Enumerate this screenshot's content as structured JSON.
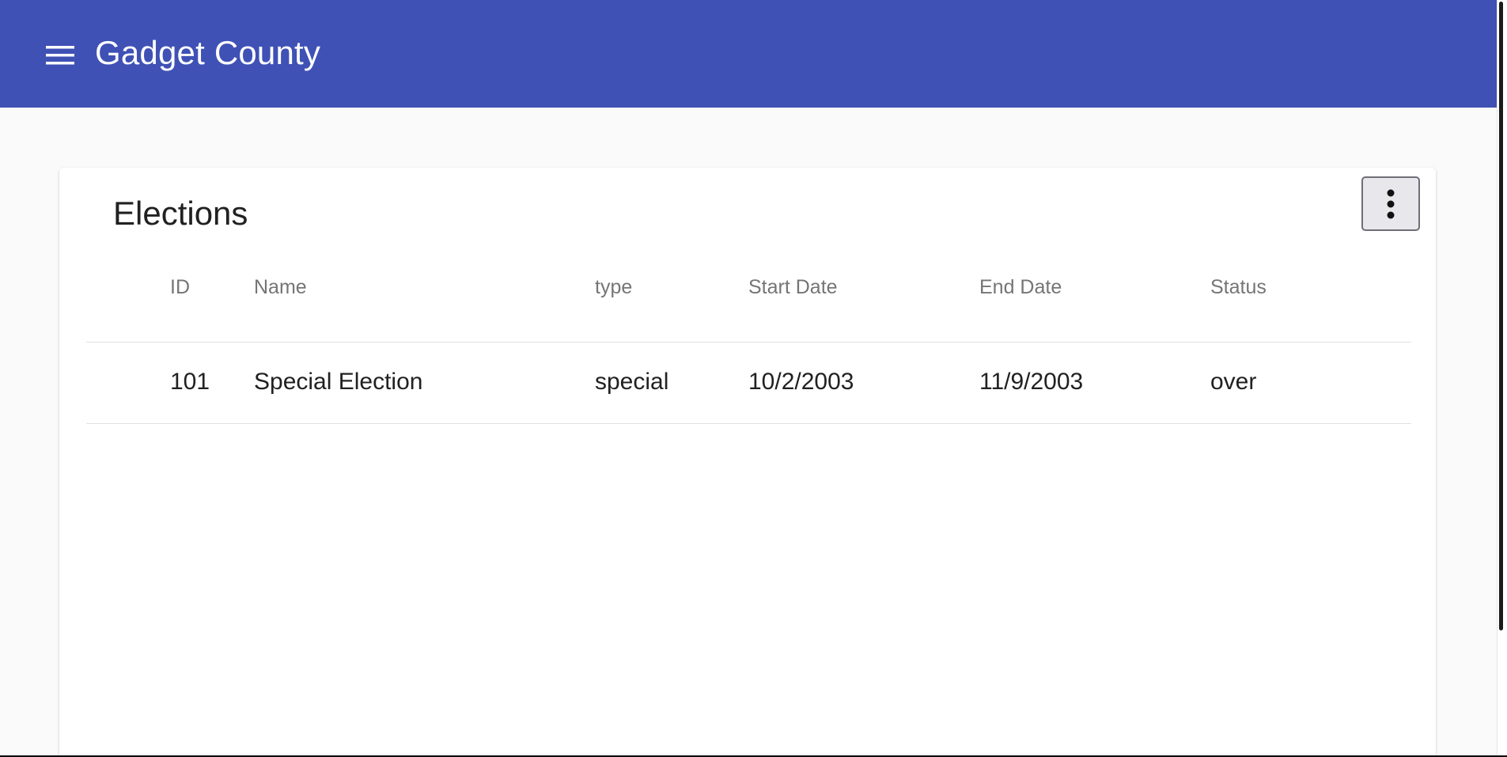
{
  "app": {
    "title": "Gadget County",
    "menu_icon": "menu-icon",
    "colors": {
      "appbar": "#3f51b5",
      "background": "#fafafa",
      "card": "#ffffff",
      "header_text": "#757575",
      "body_text": "#212121"
    }
  },
  "card": {
    "title": "Elections",
    "more_icon": "more-vertical-icon"
  },
  "table": {
    "columns": [
      "ID",
      "Name",
      "type",
      "Start Date",
      "End Date",
      "Status"
    ],
    "rows": [
      {
        "id": "101",
        "name": "Special Election",
        "type": "special",
        "start_date": "10/2/2003",
        "end_date": "11/9/2003",
        "status": "over"
      }
    ]
  }
}
